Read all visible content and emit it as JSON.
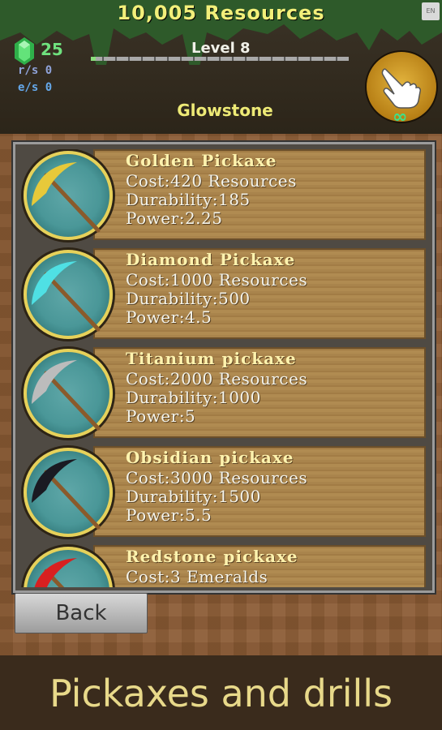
{
  "header": {
    "resources": "10,005 Resources",
    "lang": "EN",
    "emeralds": "25",
    "rate_rs": "r/s 0",
    "rate_es": "e/s 0",
    "level": "Level 8",
    "level_progress": 0.02,
    "current_block": "Glowstone",
    "auto_clicks": "∞"
  },
  "items": [
    {
      "name": "Golden Pickaxe",
      "cost": "Cost:420 Resources",
      "durability": "Durability:185",
      "power": "Power:2.25",
      "head_color": "#e7c93a",
      "icon": "golden-pickaxe-icon"
    },
    {
      "name": "Diamond Pickaxe",
      "cost": "Cost:1000 Resources",
      "durability": "Durability:500",
      "power": "Power:4.5",
      "head_color": "#4fe0e4",
      "icon": "diamond-pickaxe-icon"
    },
    {
      "name": "Titanium pickaxe",
      "cost": "Cost:2000 Resources",
      "durability": "Durability:1000",
      "power": "Power:5",
      "head_color": "#bcbcbc",
      "icon": "titanium-pickaxe-icon"
    },
    {
      "name": "Obsidian pickaxe",
      "cost": "Cost:3000 Resources",
      "durability": "Durability:1500",
      "power": "Power:5.5",
      "head_color": "#1a1a22",
      "icon": "obsidian-pickaxe-icon"
    },
    {
      "name": "Redstone pickaxe",
      "cost": "Cost:3 Emeralds",
      "durability": "",
      "power": "",
      "head_color": "#d82020",
      "icon": "redstone-pickaxe-icon"
    }
  ],
  "back_label": "Back",
  "caption": "Pickaxes and drills"
}
